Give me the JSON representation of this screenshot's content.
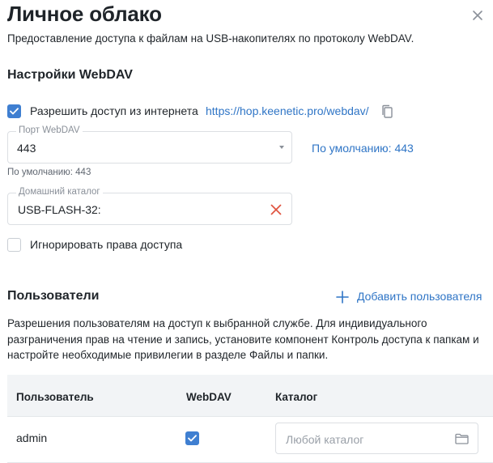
{
  "dialog": {
    "title": "Личное облако",
    "subtitle": "Предоставление доступа к файлам на USB-накопителях по протоколу WebDAV."
  },
  "webdav": {
    "heading": "Настройки WebDAV",
    "allow_internet": {
      "label": "Разрешить доступ из интернета",
      "checked": true,
      "url": "https://hop.keenetic.pro/webdav/"
    },
    "port": {
      "legend": "Порт WebDAV",
      "value": "443",
      "hint": "По умолчанию: 443",
      "default_link": "По умолчанию: 443"
    },
    "home_dir": {
      "legend": "Домашний каталог",
      "value": "USB-FLASH-32:"
    },
    "ignore_permissions": {
      "label": "Игнорировать права доступа",
      "checked": false
    }
  },
  "users": {
    "heading": "Пользователи",
    "add_label": "Добавить пользователя",
    "description": "Разрешения пользователям на доступ к выбранной службе. Для индивидуального разграничения прав на чтение и запись, установите компонент Контроль доступа к папкам и настройте необходимые привилегии в разделе Файлы и папки.",
    "columns": [
      "Пользователь",
      "WebDAV",
      "Каталог"
    ],
    "rows": [
      {
        "user": "admin",
        "webdav": true,
        "dir_placeholder": "Любой каталог"
      }
    ]
  },
  "colors": {
    "accent": "#3f7fd1",
    "link": "#2f75c6",
    "clear": "#e0533f"
  },
  "icons": [
    "close-icon",
    "check-icon",
    "copy-icon",
    "chevron-down-icon",
    "clear-icon",
    "plus-icon",
    "folder-icon"
  ]
}
